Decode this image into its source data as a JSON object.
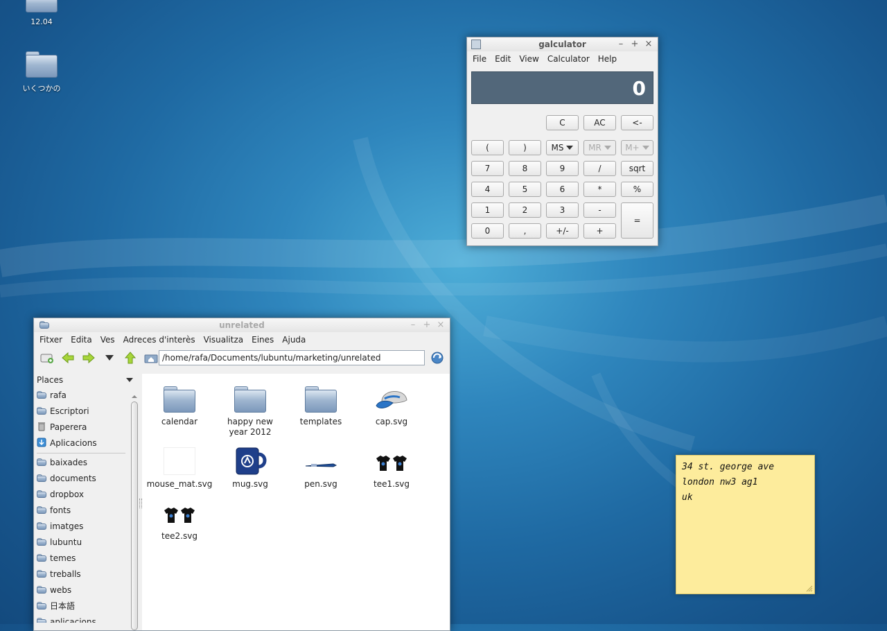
{
  "desktop": {
    "icons": [
      {
        "label": "12.04"
      },
      {
        "label": "いくつかの"
      }
    ]
  },
  "calculator": {
    "title": "galculator",
    "menu": [
      "File",
      "Edit",
      "View",
      "Calculator",
      "Help"
    ],
    "display": "0",
    "buttons": {
      "c": "C",
      "ac": "AC",
      "backspace": "<-",
      "lparen": "(",
      "rparen": ")",
      "ms": "MS",
      "mr": "MR",
      "mplus": "M+",
      "n7": "7",
      "n8": "8",
      "n9": "9",
      "div": "/",
      "sqrt": "sqrt",
      "n4": "4",
      "n5": "5",
      "n6": "6",
      "mul": "*",
      "pct": "%",
      "n1": "1",
      "n2": "2",
      "n3": "3",
      "sub": "-",
      "eq": "=",
      "n0": "0",
      "comma": ",",
      "sign": "+/-",
      "add": "+"
    }
  },
  "filemanager": {
    "title": "unrelated",
    "menu": [
      "Fitxer",
      "Edita",
      "Ves",
      "Adreces d'interès",
      "Visualitza",
      "Eines",
      "Ajuda"
    ],
    "path": "/home/rafa/Documents/lubuntu/marketing/unrelated",
    "sidebar_title": "Places",
    "places": [
      "rafa",
      "Escriptori",
      "Paperera",
      "Aplicacions"
    ],
    "bookmarks": [
      "baixades",
      "documents",
      "dropbox",
      "fonts",
      "imatges",
      "lubuntu",
      "temes",
      "treballs",
      "webs",
      "日本語",
      "aplicacions"
    ],
    "files": [
      {
        "name": "calendar",
        "kind": "folder"
      },
      {
        "name": "happy new year 2012",
        "kind": "folder"
      },
      {
        "name": "templates",
        "kind": "folder"
      },
      {
        "name": "cap.svg",
        "kind": "cap"
      },
      {
        "name": "mouse_mat.svg",
        "kind": "blank"
      },
      {
        "name": "mug.svg",
        "kind": "mug"
      },
      {
        "name": "pen.svg",
        "kind": "pen"
      },
      {
        "name": "tee1.svg",
        "kind": "tees"
      },
      {
        "name": "tee2.svg",
        "kind": "tees"
      }
    ]
  },
  "note": {
    "lines": [
      "34 st. george ave",
      "london nw3 ag1",
      "uk"
    ]
  },
  "colors": {
    "desktop": "#1f6aa3",
    "calc_display": "#52677a",
    "note": "#fdec9c"
  }
}
